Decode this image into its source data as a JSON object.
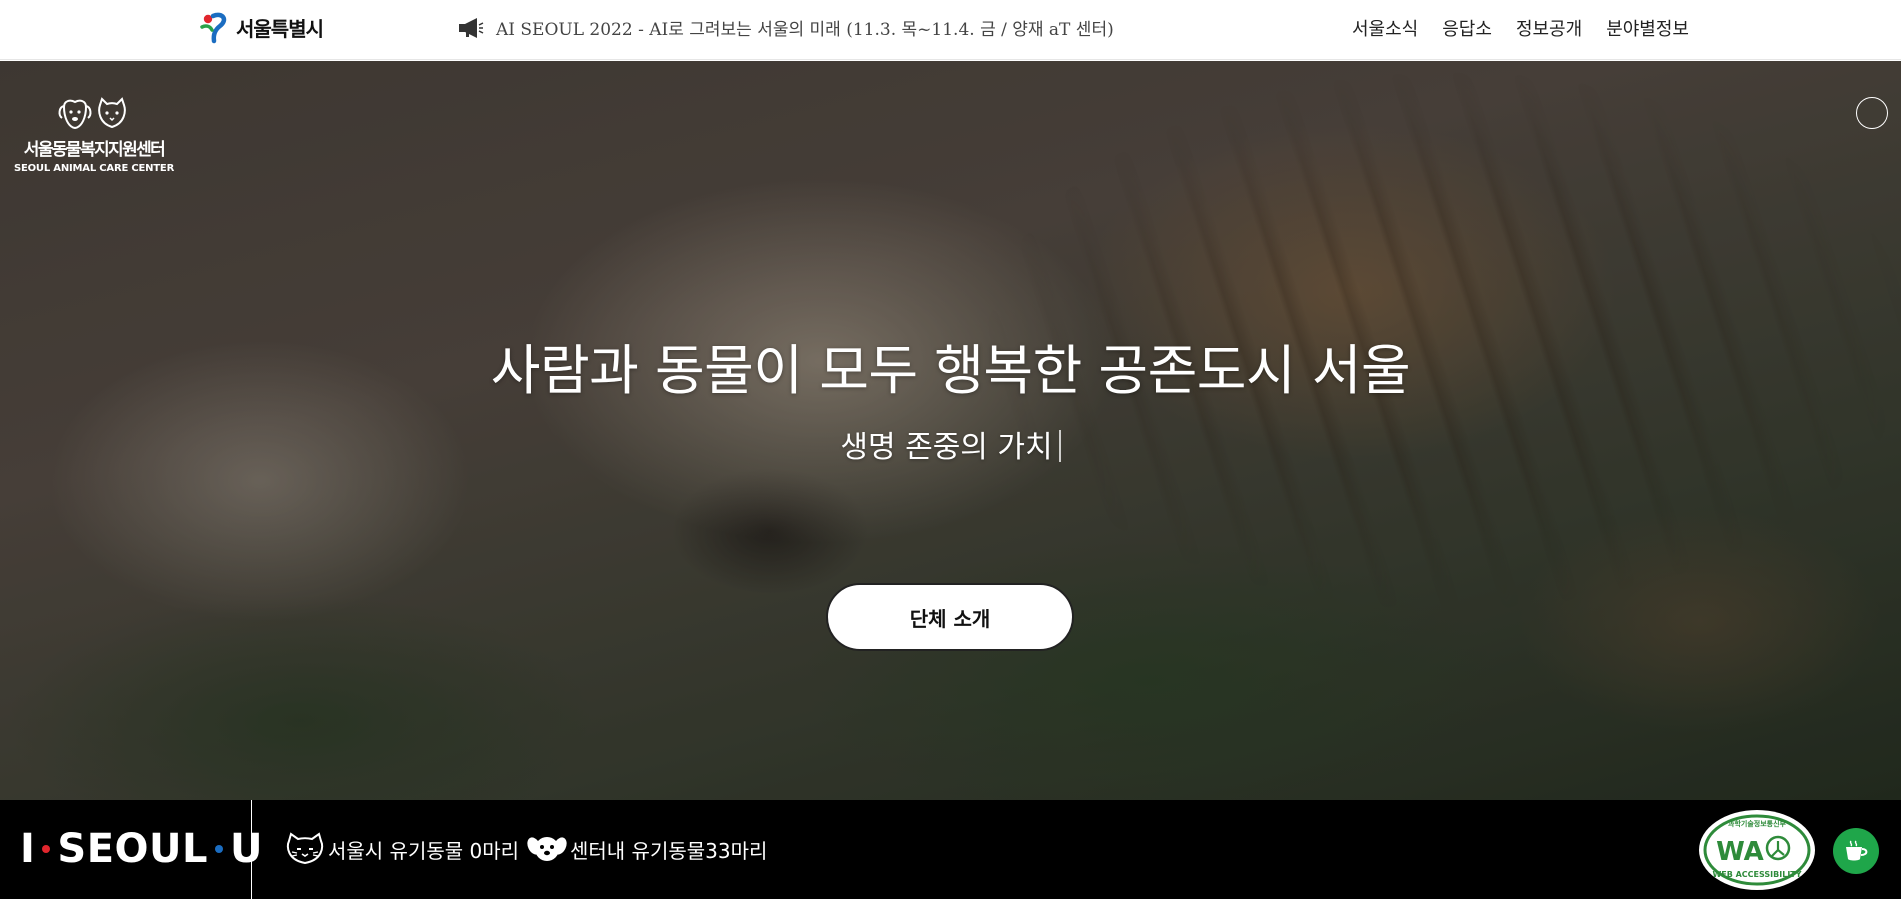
{
  "header": {
    "seoul_logo_text": "서울특별시",
    "notice_text": "AI SEOUL 2022 - AI로 그려보는 서울의 미래 (11.3. 목~11.4. 금 / 양재 aT 센터)",
    "nav": [
      "서울소식",
      "응답소",
      "정보공개",
      "분야별정보"
    ]
  },
  "site_logo": {
    "name_ko": "서울동물복지지원센터",
    "name_en": "SEOUL ANIMAL CARE CENTER"
  },
  "hero": {
    "title": "사람과 동물이 모두 행복한 공존도시 서울",
    "subtitle": "생명 존중의 가치",
    "button_label": "단체 소개"
  },
  "footer": {
    "brand": {
      "part1": "I",
      "part2": "SEOUL",
      "part3": "U"
    },
    "stats": [
      {
        "icon": "cat-face-icon",
        "label": "서울시 유기동물 0마리"
      },
      {
        "icon": "dog-face-icon",
        "label": "센터내 유기동물33마리"
      }
    ],
    "wa_badge": {
      "top_text": "과학기술정보통신부",
      "mark": "WA",
      "bottom_text": "WEB ACCESSIBILITY"
    }
  },
  "colors": {
    "seoul_red": "#e1262d",
    "seoul_blue": "#1b6dc1",
    "seoul_green": "#2aa24a",
    "wa_green": "#2e8b3a",
    "cup_green": "#1fa64a",
    "footer_bg": "#000000"
  }
}
